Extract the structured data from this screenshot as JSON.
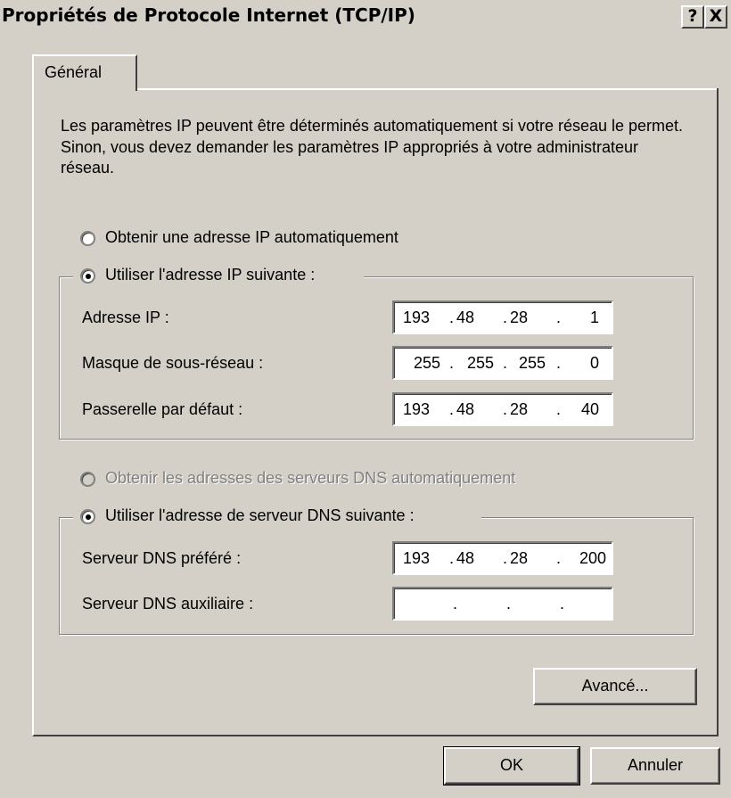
{
  "window": {
    "title": "Propriétés de Protocole Internet (TCP/IP)",
    "help_label": "?",
    "close_label": "X"
  },
  "tab": {
    "label": "Général"
  },
  "intro": "Les paramètres IP peuvent être déterminés automatiquement si votre réseau le permet. Sinon, vous devez demander les paramètres IP appropriés à votre administrateur réseau.",
  "ip_section": {
    "auto_label": "Obtenir une adresse IP automatiquement",
    "manual_label": "Utiliser l'adresse IP suivante :",
    "selected": "manual",
    "fields": [
      {
        "label": "Adresse IP :",
        "octets": [
          "193",
          "48",
          "28",
          "1"
        ]
      },
      {
        "label": "Masque de sous-réseau :",
        "octets": [
          "255",
          "255",
          "255",
          "0"
        ]
      },
      {
        "label": "Passerelle par défaut :",
        "octets": [
          "193",
          "48",
          "28",
          "40"
        ]
      }
    ]
  },
  "dns_section": {
    "auto_label": "Obtenir les adresses des serveurs DNS automatiquement",
    "auto_disabled": true,
    "manual_label": "Utiliser l'adresse de serveur DNS suivante :",
    "selected": "manual",
    "fields": [
      {
        "label": "Serveur DNS préféré :",
        "octets": [
          "193",
          "48",
          "28",
          "200"
        ]
      },
      {
        "label": "Serveur DNS auxiliaire :",
        "octets": [
          "",
          "",
          "",
          ""
        ]
      }
    ]
  },
  "buttons": {
    "advanced": "Avancé...",
    "ok": "OK",
    "cancel": "Annuler"
  },
  "colors": {
    "face": "#d4d0c8",
    "disabled_text": "#808080"
  }
}
